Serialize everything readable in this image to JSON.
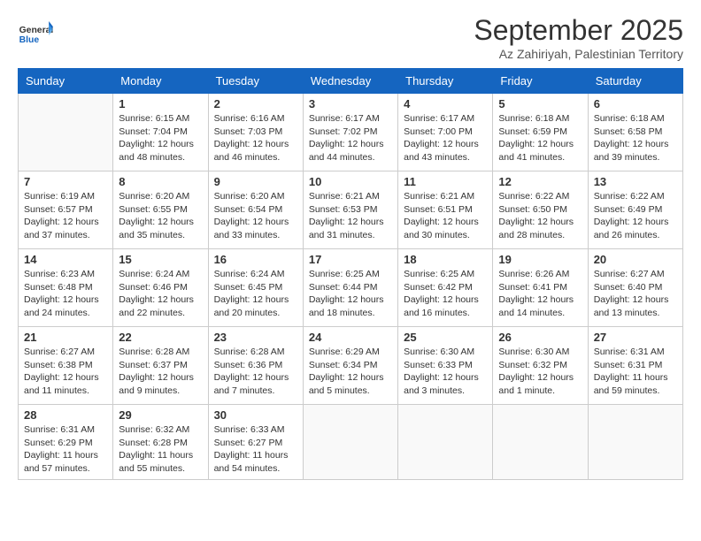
{
  "logo": {
    "general": "General",
    "blue": "Blue"
  },
  "title": "September 2025",
  "subtitle": "Az Zahiriyah, Palestinian Territory",
  "days_of_week": [
    "Sunday",
    "Monday",
    "Tuesday",
    "Wednesday",
    "Thursday",
    "Friday",
    "Saturday"
  ],
  "weeks": [
    [
      {
        "day": "",
        "info": ""
      },
      {
        "day": "1",
        "info": "Sunrise: 6:15 AM\nSunset: 7:04 PM\nDaylight: 12 hours\nand 48 minutes."
      },
      {
        "day": "2",
        "info": "Sunrise: 6:16 AM\nSunset: 7:03 PM\nDaylight: 12 hours\nand 46 minutes."
      },
      {
        "day": "3",
        "info": "Sunrise: 6:17 AM\nSunset: 7:02 PM\nDaylight: 12 hours\nand 44 minutes."
      },
      {
        "day": "4",
        "info": "Sunrise: 6:17 AM\nSunset: 7:00 PM\nDaylight: 12 hours\nand 43 minutes."
      },
      {
        "day": "5",
        "info": "Sunrise: 6:18 AM\nSunset: 6:59 PM\nDaylight: 12 hours\nand 41 minutes."
      },
      {
        "day": "6",
        "info": "Sunrise: 6:18 AM\nSunset: 6:58 PM\nDaylight: 12 hours\nand 39 minutes."
      }
    ],
    [
      {
        "day": "7",
        "info": "Sunrise: 6:19 AM\nSunset: 6:57 PM\nDaylight: 12 hours\nand 37 minutes."
      },
      {
        "day": "8",
        "info": "Sunrise: 6:20 AM\nSunset: 6:55 PM\nDaylight: 12 hours\nand 35 minutes."
      },
      {
        "day": "9",
        "info": "Sunrise: 6:20 AM\nSunset: 6:54 PM\nDaylight: 12 hours\nand 33 minutes."
      },
      {
        "day": "10",
        "info": "Sunrise: 6:21 AM\nSunset: 6:53 PM\nDaylight: 12 hours\nand 31 minutes."
      },
      {
        "day": "11",
        "info": "Sunrise: 6:21 AM\nSunset: 6:51 PM\nDaylight: 12 hours\nand 30 minutes."
      },
      {
        "day": "12",
        "info": "Sunrise: 6:22 AM\nSunset: 6:50 PM\nDaylight: 12 hours\nand 28 minutes."
      },
      {
        "day": "13",
        "info": "Sunrise: 6:22 AM\nSunset: 6:49 PM\nDaylight: 12 hours\nand 26 minutes."
      }
    ],
    [
      {
        "day": "14",
        "info": "Sunrise: 6:23 AM\nSunset: 6:48 PM\nDaylight: 12 hours\nand 24 minutes."
      },
      {
        "day": "15",
        "info": "Sunrise: 6:24 AM\nSunset: 6:46 PM\nDaylight: 12 hours\nand 22 minutes."
      },
      {
        "day": "16",
        "info": "Sunrise: 6:24 AM\nSunset: 6:45 PM\nDaylight: 12 hours\nand 20 minutes."
      },
      {
        "day": "17",
        "info": "Sunrise: 6:25 AM\nSunset: 6:44 PM\nDaylight: 12 hours\nand 18 minutes."
      },
      {
        "day": "18",
        "info": "Sunrise: 6:25 AM\nSunset: 6:42 PM\nDaylight: 12 hours\nand 16 minutes."
      },
      {
        "day": "19",
        "info": "Sunrise: 6:26 AM\nSunset: 6:41 PM\nDaylight: 12 hours\nand 14 minutes."
      },
      {
        "day": "20",
        "info": "Sunrise: 6:27 AM\nSunset: 6:40 PM\nDaylight: 12 hours\nand 13 minutes."
      }
    ],
    [
      {
        "day": "21",
        "info": "Sunrise: 6:27 AM\nSunset: 6:38 PM\nDaylight: 12 hours\nand 11 minutes."
      },
      {
        "day": "22",
        "info": "Sunrise: 6:28 AM\nSunset: 6:37 PM\nDaylight: 12 hours\nand 9 minutes."
      },
      {
        "day": "23",
        "info": "Sunrise: 6:28 AM\nSunset: 6:36 PM\nDaylight: 12 hours\nand 7 minutes."
      },
      {
        "day": "24",
        "info": "Sunrise: 6:29 AM\nSunset: 6:34 PM\nDaylight: 12 hours\nand 5 minutes."
      },
      {
        "day": "25",
        "info": "Sunrise: 6:30 AM\nSunset: 6:33 PM\nDaylight: 12 hours\nand 3 minutes."
      },
      {
        "day": "26",
        "info": "Sunrise: 6:30 AM\nSunset: 6:32 PM\nDaylight: 12 hours\nand 1 minute."
      },
      {
        "day": "27",
        "info": "Sunrise: 6:31 AM\nSunset: 6:31 PM\nDaylight: 11 hours\nand 59 minutes."
      }
    ],
    [
      {
        "day": "28",
        "info": "Sunrise: 6:31 AM\nSunset: 6:29 PM\nDaylight: 11 hours\nand 57 minutes."
      },
      {
        "day": "29",
        "info": "Sunrise: 6:32 AM\nSunset: 6:28 PM\nDaylight: 11 hours\nand 55 minutes."
      },
      {
        "day": "30",
        "info": "Sunrise: 6:33 AM\nSunset: 6:27 PM\nDaylight: 11 hours\nand 54 minutes."
      },
      {
        "day": "",
        "info": ""
      },
      {
        "day": "",
        "info": ""
      },
      {
        "day": "",
        "info": ""
      },
      {
        "day": "",
        "info": ""
      }
    ]
  ]
}
